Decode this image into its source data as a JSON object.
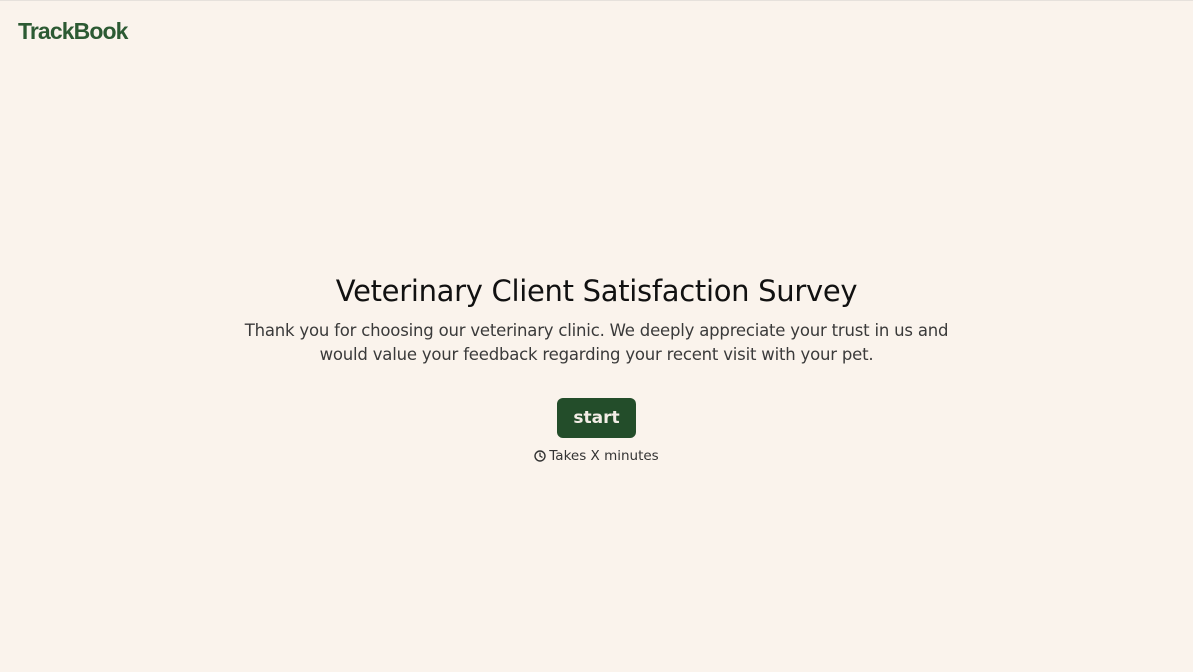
{
  "header": {
    "logo_text": "TrackBook"
  },
  "survey": {
    "title": "Veterinary Client Satisfaction Survey",
    "description": "Thank you for choosing our veterinary clinic. We deeply appreciate your trust in us and would value your feedback regarding your recent visit with your pet.",
    "start_label": "start",
    "duration_icon": "clock-icon",
    "duration_text": "Takes X minutes"
  },
  "colors": {
    "background": "#faf3ec",
    "brand": "#2c5a33",
    "button": "#234d2a",
    "button_text": "#f3ede6"
  }
}
